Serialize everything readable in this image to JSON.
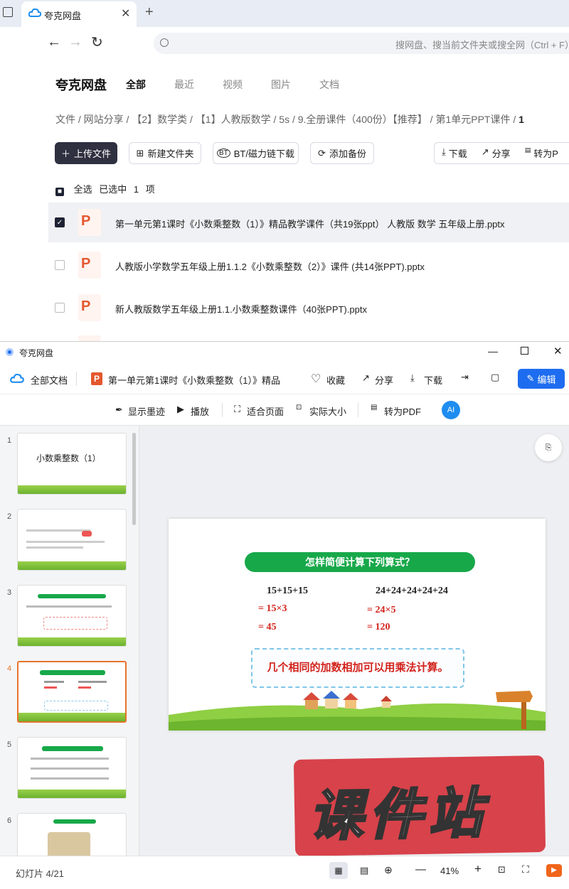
{
  "browser": {
    "tab_title": "夸克网盘",
    "address_placeholder": "搜网盘、搜当前文件夹或搜全网（Ctrl + F）"
  },
  "netdisk": {
    "brand": "夸克网盘",
    "tabs": [
      "全部",
      "最近",
      "视频",
      "图片",
      "文档"
    ],
    "breadcrumb": [
      "文件",
      "网站分享",
      "【2】数学类",
      "【1】人教版数学",
      "5s",
      "9.全册课件（400份）【推荐】",
      "第1单元PPT课件",
      "1"
    ],
    "actions": {
      "upload": "上传文件",
      "new_folder": "新建文件夹",
      "bt": "BT/磁力链下载",
      "backup": "添加备份",
      "download": "下载",
      "share": "分享",
      "to_pdf": "转为P"
    },
    "select_all": "全选",
    "selected": "已选中",
    "selected_count": "1",
    "selected_unit": "项",
    "files": [
      {
        "name": "第一单元第1课时《小数乘整数（1）》精品教学课件（共19张ppt） 人教版 数学 五年级上册.pptx",
        "checked": true
      },
      {
        "name": "人教版小学数学五年级上册1.1.2《小数乘整数（2）》课件 (共14张PPT).pptx",
        "checked": false
      },
      {
        "name": "新人教版数学五年级上册1.1.小数乘整数课件（40张PPT).pptx",
        "checked": false
      }
    ]
  },
  "viewer": {
    "window_title": "夸克网盘",
    "all_docs": "全部文档",
    "doc_title": "第一单元第1课时《小数乘整数（1）》精品",
    "favorite": "收藏",
    "share": "分享",
    "download": "下载",
    "edit": "编辑",
    "toolbar": {
      "show_ink": "显示墨迹",
      "play": "播放",
      "fit_page": "适合页面",
      "actual_size": "实际大小",
      "to_pdf": "转为PDF"
    },
    "thumbs": [
      {
        "num": "1",
        "title": "小数乘整数（1）"
      },
      {
        "num": "2"
      },
      {
        "num": "3"
      },
      {
        "num": "4"
      },
      {
        "num": "5"
      },
      {
        "num": "6"
      }
    ],
    "slide": {
      "header": "怎样简便计算下列算式？",
      "left": [
        "15+15+15",
        "= 15×3",
        "= 45"
      ],
      "right": [
        "24+24+24+24+24",
        "= 24×5",
        "= 120"
      ],
      "note": "几个相同的加数相加可以用乘法计算。"
    },
    "status": {
      "slide_counter": "幻灯片 4/21",
      "zoom": "41%"
    },
    "watermark": "课件站"
  }
}
